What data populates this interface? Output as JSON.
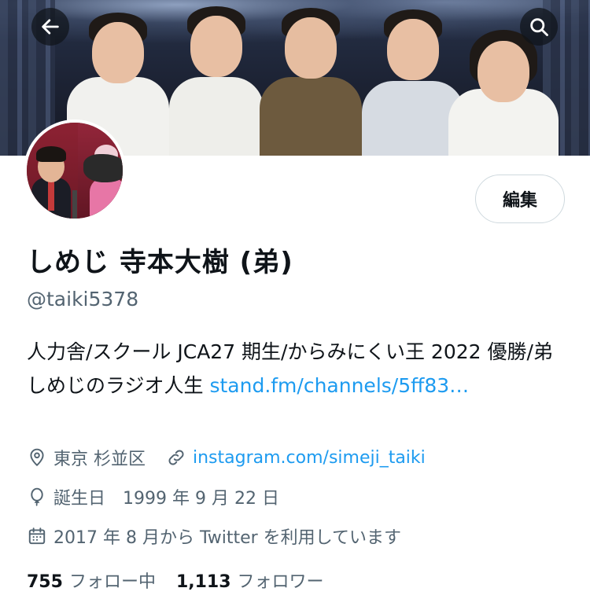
{
  "header": {
    "back_icon": "arrow-left-icon",
    "search_icon": "search-icon"
  },
  "profile": {
    "edit_label": "編集",
    "display_name": "しめじ 寺本大樹 (弟)",
    "handle": "@taiki5378",
    "bio_text": "人力舎/スクール JCA27 期生/からみにくい王 2022 優勝/弟 しめじのラジオ人生 ",
    "bio_link": "stand.fm/channels/5ff83…",
    "location": "東京 杉並区",
    "website": "instagram.com/simeji_taiki",
    "birthday": "誕生日　1999 年 9 月 22 日",
    "joined": "2017 年 8 月から Twitter を利用しています"
  },
  "stats": {
    "following_count": "755",
    "following_label": "フォロー中",
    "followers_count": "1,113",
    "followers_label": "フォロワー"
  },
  "colors": {
    "link": "#1d9bf0",
    "secondary_text": "#536471",
    "primary_text": "#0f1419"
  }
}
